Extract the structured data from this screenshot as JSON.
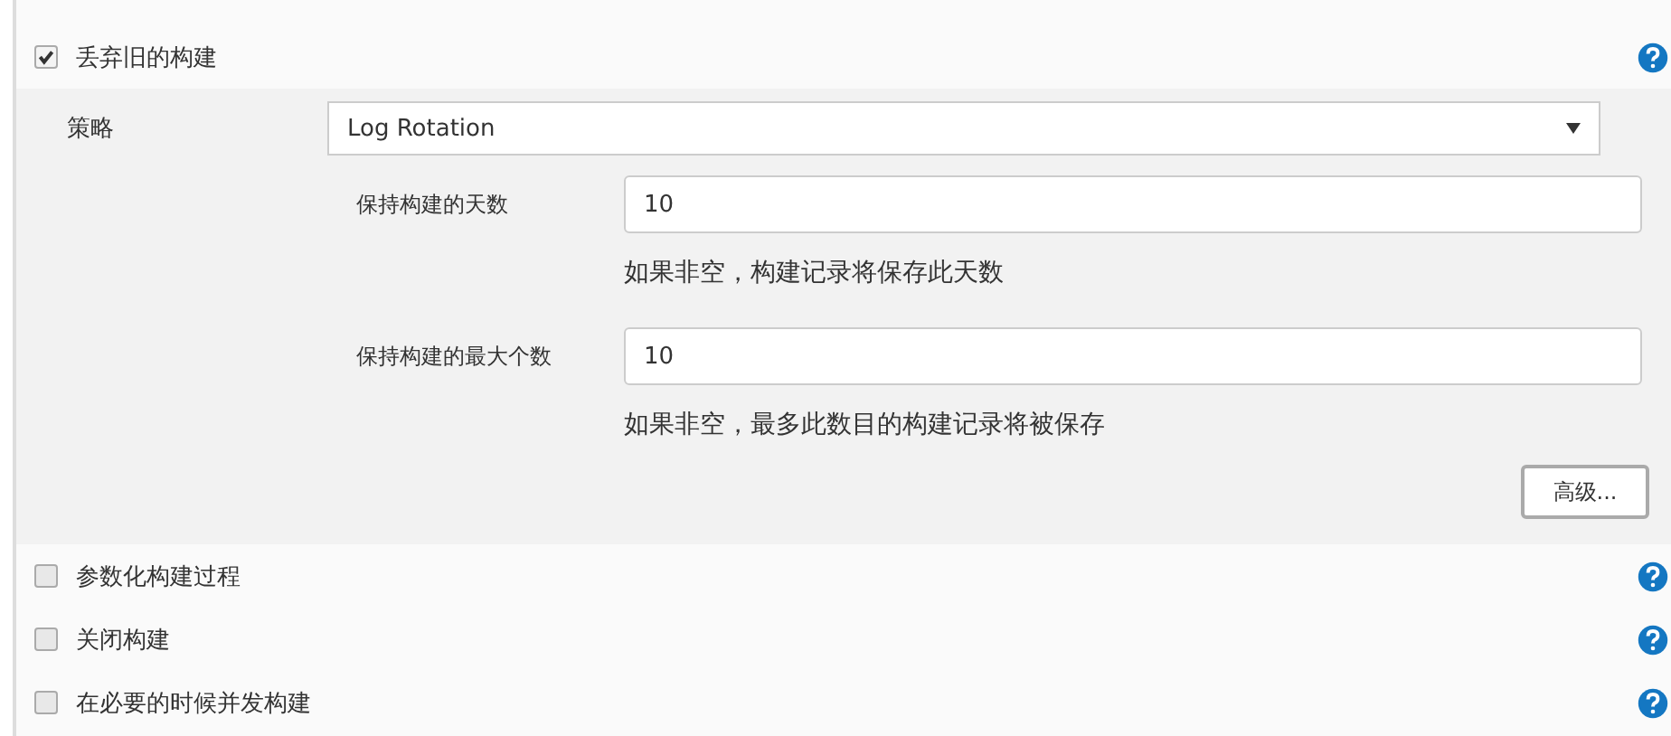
{
  "discard_old_builds": {
    "label": "丢弃旧的构建",
    "checked": true,
    "strategy": {
      "label": "策略",
      "value": "Log Rotation"
    },
    "fields": [
      {
        "label": "保持构建的天数",
        "value": "10",
        "hint": "如果非空，构建记录将保存此天数"
      },
      {
        "label": "保持构建的最大个数",
        "value": "10",
        "hint": "如果非空，最多此数目的构建记录将被保存"
      }
    ],
    "advanced_button": "高级..."
  },
  "options": [
    {
      "label": "参数化构建过程",
      "checked": false
    },
    {
      "label": "关闭构建",
      "checked": false
    },
    {
      "label": "在必要的时候并发构建",
      "checked": false
    }
  ]
}
